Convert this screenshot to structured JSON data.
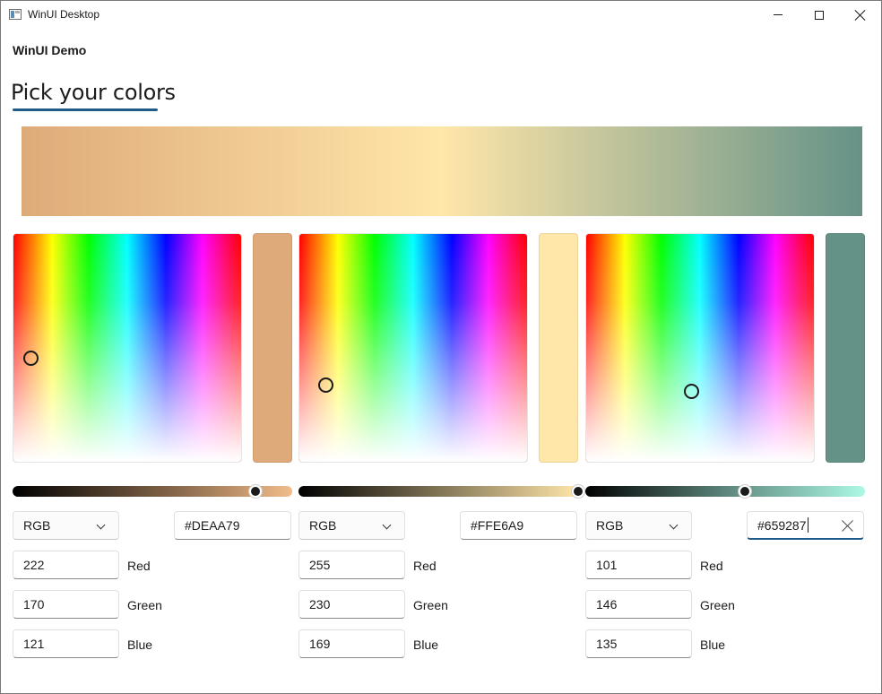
{
  "window": {
    "title": "WinUI Desktop"
  },
  "app": {
    "name": "WinUI Demo"
  },
  "tab": {
    "label": "Pick your colors"
  },
  "gradient": {
    "colors": [
      "#DEAA79",
      "#FFE6A9",
      "#659287"
    ]
  },
  "pickers": [
    {
      "color": "#DEAA79",
      "mode": "RGB",
      "hex": "#DEAA79",
      "channels": [
        {
          "value": "222",
          "label": "Red"
        },
        {
          "value": "170",
          "label": "Green"
        },
        {
          "value": "121",
          "label": "Blue"
        }
      ],
      "slider_level": 0.87
    },
    {
      "color": "#FFE6A9",
      "mode": "RGB",
      "hex": "#FFE6A9",
      "channels": [
        {
          "value": "255",
          "label": "Red"
        },
        {
          "value": "230",
          "label": "Green"
        },
        {
          "value": "169",
          "label": "Blue"
        }
      ],
      "slider_level": 1.0
    },
    {
      "color": "#659287",
      "mode": "RGB",
      "hex": "#659287",
      "channels": [
        {
          "value": "101",
          "label": "Red"
        },
        {
          "value": "146",
          "label": "Green"
        },
        {
          "value": "135",
          "label": "Blue"
        }
      ],
      "slider_level": 0.57
    }
  ],
  "icons": {
    "app": "app-window-icon",
    "minimize": "minimize-icon",
    "maximize": "maximize-icon",
    "close": "close-icon",
    "dropdown": "chevron-down-icon",
    "clear": "clear-icon"
  }
}
